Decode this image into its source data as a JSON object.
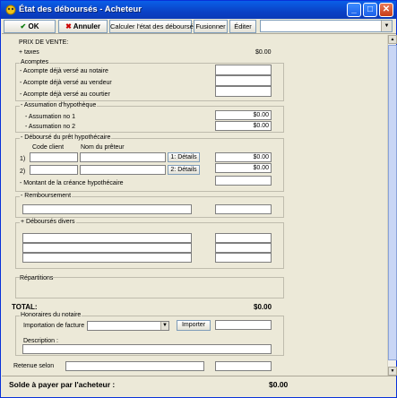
{
  "window": {
    "title": "État des déboursés - Acheteur",
    "minimize": "_",
    "maximize": "□",
    "close": "✕"
  },
  "toolbar": {
    "ok_label": "OK",
    "cancel_label": "Annuler",
    "calc_label": "Calculer l'état des déboursés",
    "merge_label": "Fusionner",
    "edit_label": "Éditer",
    "combo_value": ""
  },
  "prix": {
    "title": "PRIX DE VENTE:",
    "taxes_label": "+ taxes",
    "taxes_value": "$0.00"
  },
  "acomptes": {
    "title": "Acomptes",
    "rows": [
      {
        "label": "- Acompte déjà versé au notaire",
        "value": ""
      },
      {
        "label": "- Acompte déjà versé au vendeur",
        "value": ""
      },
      {
        "label": "- Acompte déjà versé au courtier",
        "value": ""
      }
    ]
  },
  "assumation": {
    "title": "- Assumation d'hypothèque",
    "rows": [
      {
        "label": "- Assumation no 1",
        "value": "$0.00"
      },
      {
        "label": "- Assumation no 2",
        "value": "$0.00"
      }
    ]
  },
  "debourse": {
    "title": "- Déboursé du prêt hypothécaire",
    "code_header": "Code client",
    "nom_header": "Nom du prêteur",
    "rows": [
      {
        "num": "1)",
        "details": "1: Détails",
        "value": "$0.00"
      },
      {
        "num": "2)",
        "details": "2: Détails",
        "value": "$0.00"
      }
    ],
    "montant_label": "- Montant de la créance hypothécaire",
    "montant_value": ""
  },
  "remboursement": {
    "title": "- Remboursement"
  },
  "debourses_divers": {
    "title": "+ Déboursés divers"
  },
  "repartitions": {
    "title": "Répartitions"
  },
  "total": {
    "label": "TOTAL:",
    "value": "$0.00"
  },
  "honoraires": {
    "title": "Honoraires du notaire",
    "import_label": "Importation de facture",
    "import_button": "Importer",
    "description_label": "Description :"
  },
  "retenue": {
    "label": "Retenue selon"
  },
  "footer": {
    "label": "Solde à payer par l'acheteur :",
    "value": "$0.00"
  }
}
